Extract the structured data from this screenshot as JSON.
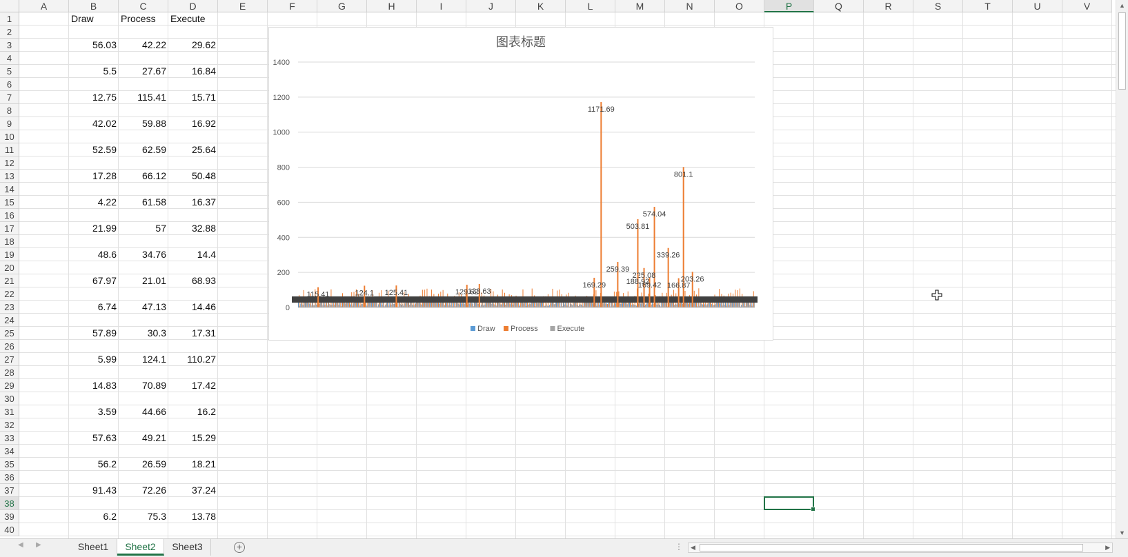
{
  "sheet": {
    "columns": [
      "A",
      "B",
      "C",
      "D",
      "E",
      "F",
      "G",
      "H",
      "I",
      "J",
      "K",
      "L",
      "M",
      "N",
      "O",
      "P",
      "Q",
      "R",
      "S",
      "T",
      "U",
      "V"
    ],
    "selected_column": "P",
    "rows": [
      "1",
      "2",
      "3",
      "4",
      "5",
      "6",
      "7",
      "8",
      "9",
      "10",
      "11",
      "12",
      "13",
      "14",
      "15",
      "16",
      "17",
      "18",
      "19",
      "20",
      "21",
      "22",
      "23",
      "24",
      "25",
      "26",
      "27",
      "28",
      "29",
      "30",
      "31",
      "32",
      "33",
      "34",
      "35",
      "36",
      "37",
      "38",
      "39",
      "40"
    ],
    "selected_row": "38",
    "headers": {
      "B": "Draw",
      "C": "Process",
      "D": "Execute"
    },
    "data_rows": [
      {
        "row": "3",
        "B": "56.03",
        "C": "42.22",
        "D": "29.62"
      },
      {
        "row": "5",
        "B": "5.5",
        "C": "27.67",
        "D": "16.84"
      },
      {
        "row": "7",
        "B": "12.75",
        "C": "115.41",
        "D": "15.71"
      },
      {
        "row": "9",
        "B": "42.02",
        "C": "59.88",
        "D": "16.92"
      },
      {
        "row": "11",
        "B": "52.59",
        "C": "62.59",
        "D": "25.64"
      },
      {
        "row": "13",
        "B": "17.28",
        "C": "66.12",
        "D": "50.48"
      },
      {
        "row": "15",
        "B": "4.22",
        "C": "61.58",
        "D": "16.37"
      },
      {
        "row": "17",
        "B": "21.99",
        "C": "57",
        "D": "32.88"
      },
      {
        "row": "19",
        "B": "48.6",
        "C": "34.76",
        "D": "14.4"
      },
      {
        "row": "21",
        "B": "67.97",
        "C": "21.01",
        "D": "68.93"
      },
      {
        "row": "23",
        "B": "6.74",
        "C": "47.13",
        "D": "14.46"
      },
      {
        "row": "25",
        "B": "57.89",
        "C": "30.3",
        "D": "17.31"
      },
      {
        "row": "27",
        "B": "5.99",
        "C": "124.1",
        "D": "110.27"
      },
      {
        "row": "29",
        "B": "14.83",
        "C": "70.89",
        "D": "17.42"
      },
      {
        "row": "31",
        "B": "3.59",
        "C": "44.66",
        "D": "16.2"
      },
      {
        "row": "33",
        "B": "57.63",
        "C": "49.21",
        "D": "15.29"
      },
      {
        "row": "35",
        "B": "56.2",
        "C": "26.59",
        "D": "18.21"
      },
      {
        "row": "37",
        "B": "91.43",
        "C": "72.26",
        "D": "37.24"
      },
      {
        "row": "39",
        "B": "6.2",
        "C": "75.3",
        "D": "13.78"
      }
    ]
  },
  "chart_data": {
    "type": "bar",
    "title": "图表标题",
    "ylim": [
      0,
      1400
    ],
    "yticks": [
      "0",
      "200",
      "400",
      "600",
      "800",
      "1000",
      "1200",
      "1400"
    ],
    "grid": true,
    "legend_position": "bottom",
    "colors": {
      "Draw": "#5b9bd5",
      "Process": "#ed7d31",
      "Execute": "#a5a5a5"
    },
    "series": [
      {
        "name": "Draw"
      },
      {
        "name": "Process"
      },
      {
        "name": "Execute"
      }
    ],
    "background_note": "many small bars with overlapping dark data labels near zero",
    "highlighted_points": [
      {
        "series": "Process",
        "value": 1171.69
      },
      {
        "series": "Process",
        "value": 801.1
      },
      {
        "series": "Process",
        "value": 574.04
      },
      {
        "series": "Process",
        "value": 503.81
      },
      {
        "series": "Process",
        "value": 339.26
      },
      {
        "series": "Process",
        "value": 259.39
      },
      {
        "series": "Process",
        "value": 225.08
      },
      {
        "series": "Process",
        "value": 203.26
      },
      {
        "series": "Process",
        "value": 188.92
      },
      {
        "series": "Process",
        "value": 169.42
      },
      {
        "series": "Process",
        "value": 169.29
      },
      {
        "series": "Process",
        "value": 166.87
      },
      {
        "series": "Process",
        "value": 133.63
      },
      {
        "series": "Process",
        "value": 129.62
      },
      {
        "series": "Process",
        "value": 125.41
      },
      {
        "series": "Process",
        "value": 124.1
      },
      {
        "series": "Process",
        "value": 115.41
      }
    ]
  },
  "tabs": [
    {
      "label": "Sheet1",
      "active": false
    },
    {
      "label": "Sheet2",
      "active": true
    },
    {
      "label": "Sheet3",
      "active": false
    }
  ],
  "add_sheet_label": "+",
  "scroll_dots": "⋮"
}
